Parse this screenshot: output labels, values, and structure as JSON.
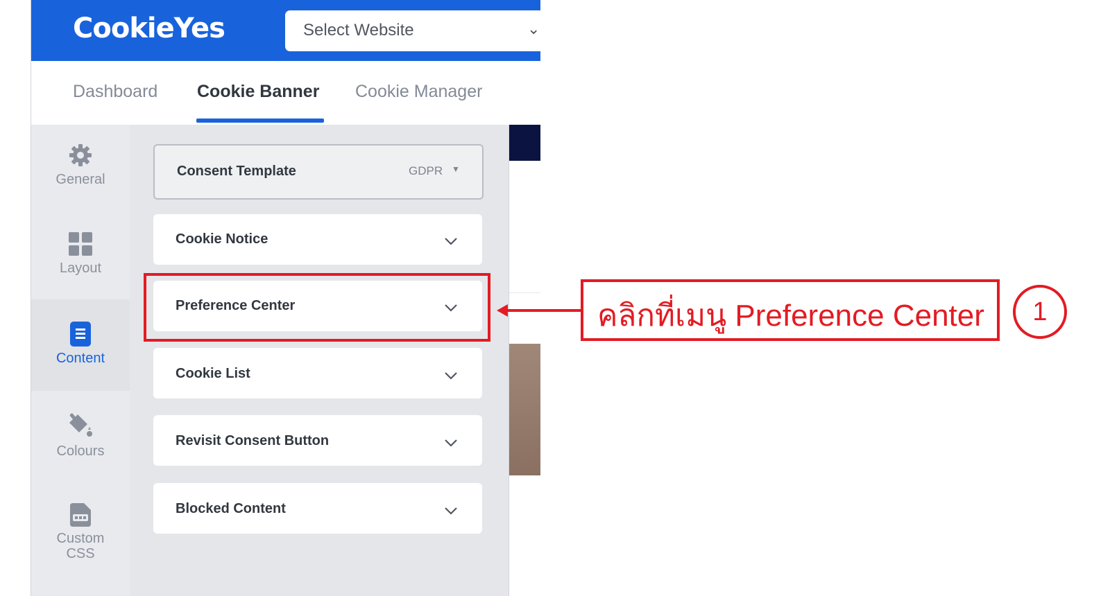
{
  "header": {
    "logo_text": "CookieYes",
    "website_select_placeholder": "Select Website"
  },
  "nav": {
    "tabs": [
      {
        "label": "Dashboard",
        "active": false
      },
      {
        "label": "Cookie Banner",
        "active": true
      },
      {
        "label": "Cookie Manager",
        "active": false
      }
    ]
  },
  "sidebar": {
    "items": [
      {
        "label": "General",
        "icon": "gear-icon",
        "active": false
      },
      {
        "label": "Layout",
        "icon": "grid-icon",
        "active": false
      },
      {
        "label": "Content",
        "icon": "document-icon",
        "active": true
      },
      {
        "label": "Colours",
        "icon": "paint-bucket-icon",
        "active": false
      },
      {
        "label": "Custom CSS",
        "label_line1": "Custom",
        "label_line2": "CSS",
        "icon": "css-file-icon",
        "active": false
      }
    ]
  },
  "content": {
    "consent_template": {
      "label": "Consent Template",
      "value": "GDPR"
    },
    "sections": [
      {
        "label": "Cookie Notice"
      },
      {
        "label": "Preference Center"
      },
      {
        "label": "Cookie List"
      },
      {
        "label": "Revisit Consent Button"
      },
      {
        "label": "Blocked Content"
      }
    ]
  },
  "annotation": {
    "callout_text": "คลิกที่เมนู Preference Center",
    "step_number": "1",
    "color": "#e31b23"
  },
  "colors": {
    "brand_blue": "#1863dc",
    "active_tab_underline": "#1863dc"
  }
}
